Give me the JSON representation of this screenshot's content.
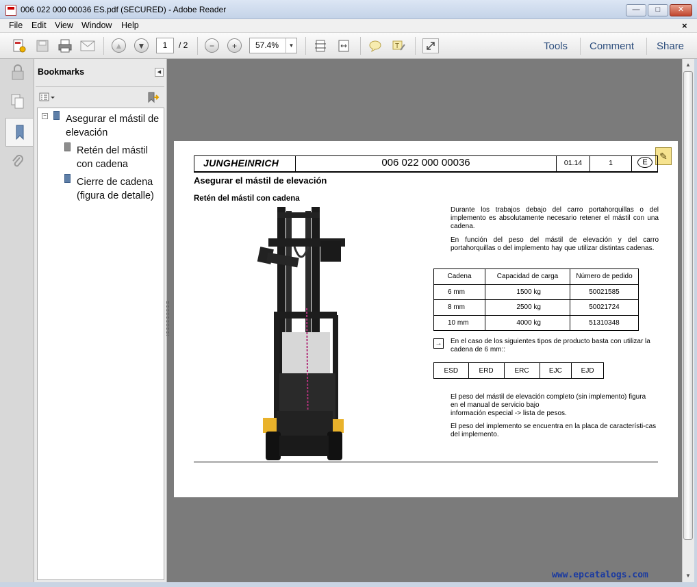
{
  "window": {
    "title": "006 022 000 00036 ES.pdf (SECURED) - Adobe Reader",
    "minimize": "—",
    "maximize": "□",
    "close": "✕"
  },
  "menu": [
    "File",
    "Edit",
    "View",
    "Window",
    "Help"
  ],
  "doc_close": "×",
  "toolbar": {
    "page_current": "1",
    "page_total": "/ 2",
    "zoom": "57.4%",
    "links": [
      "Tools",
      "Comment",
      "Share"
    ]
  },
  "bookmarks": {
    "title": "Bookmarks",
    "items": [
      {
        "label_line1": "Asegurar el mástil de",
        "label_line2": "elevación"
      },
      {
        "label_line1": "Retén del mástil",
        "label_line2": "con cadena"
      },
      {
        "label_line1": "Cierre de cadena",
        "label_line2": "(figura de detalle)"
      }
    ]
  },
  "page": {
    "brand": "JUNGHEINRICH",
    "doc_number": "006 022 000 00036",
    "date": "01.14",
    "page": "1",
    "lang": "E",
    "heading": "Asegurar el mástil de elevación",
    "subheading": "Retén del mástil con cadena",
    "para1": "Durante los trabajos debajo del carro portahorquillas o del implemento es absolutamente necesario retener el mástil con una cadena.",
    "para2": "En función del peso del mástil de elevación y del carro portahorquillas o del implemento hay que utilizar distintas cadenas.",
    "chain_table": {
      "headers": [
        "Cadena",
        "Capacidad de carga",
        "Número de pedido"
      ],
      "rows": [
        [
          "6 mm",
          "1500 kg",
          "50021585"
        ],
        [
          "8 mm",
          "2500 kg",
          "50021724"
        ],
        [
          "10 mm",
          "4000 kg",
          "51310348"
        ]
      ]
    },
    "note_arrow": "→",
    "note": "En el caso de los siguientes tipos de producto basta con utilizar la cadena de 6 mm::",
    "product_types": [
      "ESD",
      "ERD",
      "ERC",
      "EJC",
      "EJD"
    ],
    "para3_line1": "El peso del mástil de elevación completo (sin implemento) figura",
    "para3_line2": "en el manual de servicio bajo",
    "para3_line3": "información especial -> lista de pesos.",
    "para4": "El peso del implemento se encuentra en la placa de característi-cas del implemento."
  },
  "watermark": "www.epcatalogs.com"
}
